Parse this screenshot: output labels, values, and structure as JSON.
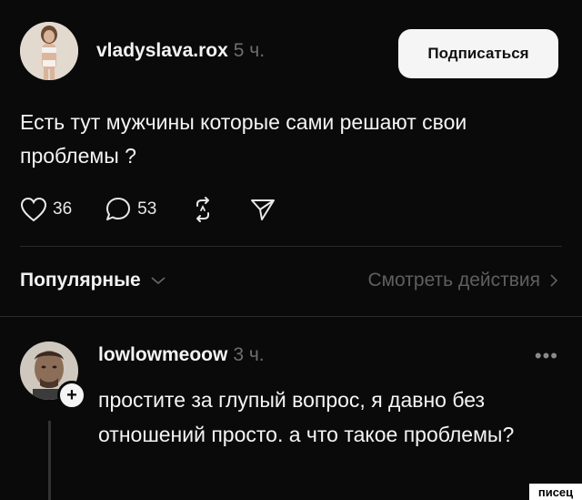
{
  "post": {
    "username": "vladyslava.rox",
    "time": "5 ч.",
    "follow_label": "Подписаться",
    "text": "Есть тут мужчины которые сами решают свои проблемы ?",
    "likes": "36",
    "comments": "53",
    "icons": [
      "heart-icon",
      "comment-icon",
      "repost-icon",
      "send-icon"
    ]
  },
  "filter": {
    "sort_label": "Популярные",
    "activity_label": "Смотреть действия"
  },
  "comment": {
    "username": "lowlowmeoow",
    "time": "3 ч.",
    "more": "•••",
    "text": "простите за глупый вопрос, я давно без отношений просто. а что такое проблемы?",
    "plus": "+"
  },
  "watermark": "писец",
  "colors": {
    "background": "#0a0a0a",
    "text": "#f4f4f4",
    "muted": "#6e6e6e",
    "button_bg": "#f5f5f5"
  }
}
